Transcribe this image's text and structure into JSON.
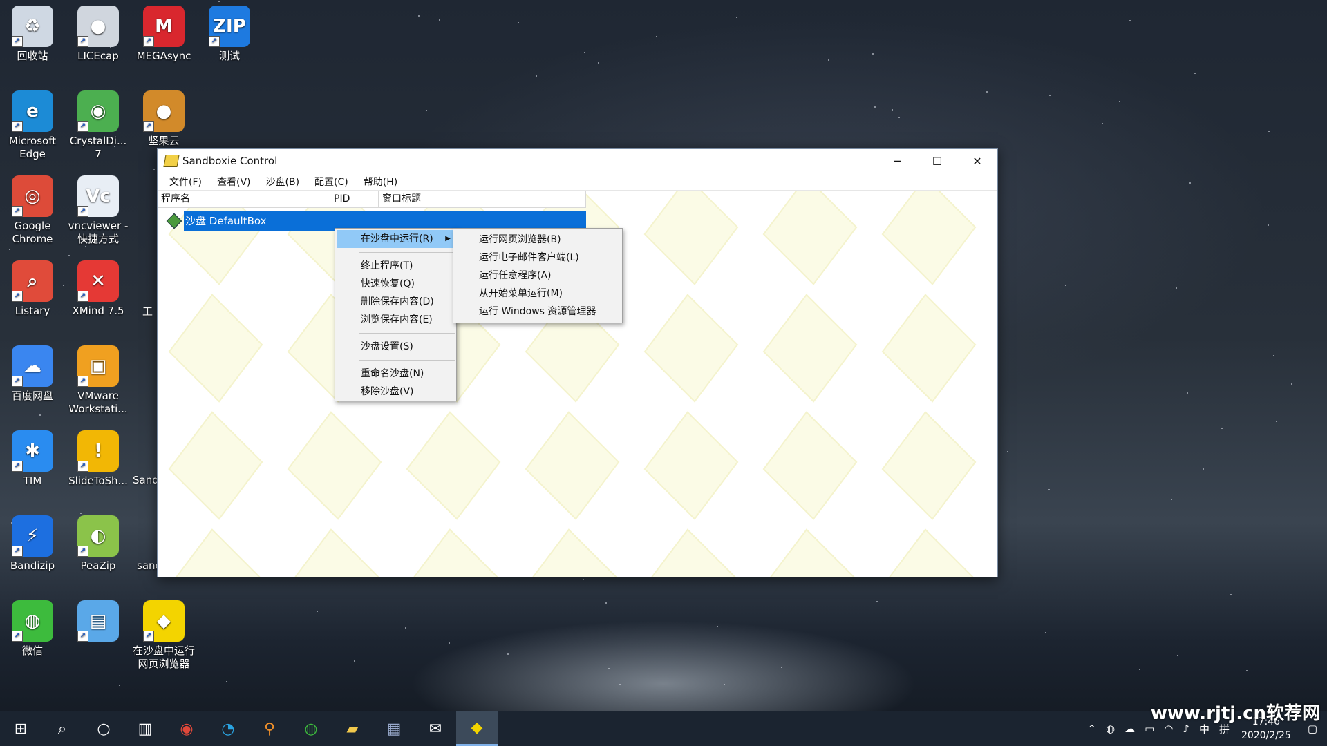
{
  "desktop": {
    "icons": [
      {
        "label": "回收站",
        "glyph": "♻",
        "color": "#cfd8e3"
      },
      {
        "label": "LICEcap",
        "glyph": "●",
        "color": "#d0d6de"
      },
      {
        "label": "MEGAsync",
        "glyph": "M",
        "color": "#d9272e"
      },
      {
        "label": "测试",
        "glyph": "ZIP",
        "color": "#1e7ae0"
      },
      {
        "label": "Microsoft Edge",
        "glyph": "e",
        "color": "#1c8bd6"
      },
      {
        "label": "CrystalDi... 7",
        "glyph": "◉",
        "color": "#4caf50"
      },
      {
        "label": "坚果云",
        "glyph": "●",
        "color": "#d28a2a"
      },
      {
        "label": "Google Chrome",
        "glyph": "◎",
        "color": "#dd4b39"
      },
      {
        "label": "vncviewer - 快捷方式",
        "glyph": "Vc",
        "color": "#e8eef5"
      },
      {
        "label": "Listary",
        "glyph": "⌕",
        "color": "#e04b3a"
      },
      {
        "label": "XMind 7.5",
        "glyph": "✕",
        "color": "#e53935"
      },
      {
        "label": "百度网盘",
        "glyph": "☁",
        "color": "#3a86f0"
      },
      {
        "label": "VMware Workstati...",
        "glyph": "▣",
        "color": "#f0a020"
      },
      {
        "label": "TIM",
        "glyph": "✱",
        "color": "#2a8cf0"
      },
      {
        "label": "SlideToSh...",
        "glyph": "!",
        "color": "#f2b705"
      },
      {
        "label": "Bandizip",
        "glyph": "⚡",
        "color": "#1d6fe0"
      },
      {
        "label": "PeaZip",
        "glyph": "◐",
        "color": "#8bc34a"
      },
      {
        "label": "微信",
        "glyph": "◍",
        "color": "#3dbb3d"
      },
      {
        "label": "",
        "glyph": "▤",
        "color": "#5aa8e8"
      },
      {
        "label": "在沙盘中运行网页浏览器",
        "glyph": "◆",
        "color": "#f3d400"
      }
    ],
    "partial_labels": [
      "工",
      "Sand",
      "sand"
    ]
  },
  "window": {
    "title": "Sandboxie Control",
    "controls": {
      "minimize": "─",
      "maximize": "☐",
      "close": "✕"
    },
    "menubar": [
      "文件(F)",
      "查看(V)",
      "沙盘(B)",
      "配置(C)",
      "帮助(H)"
    ],
    "columns": [
      "程序名",
      "PID",
      "窗口标题"
    ],
    "selected_row": "沙盘 DefaultBox"
  },
  "context_menu": {
    "items": [
      "在沙盘中运行(R)",
      "终止程序(T)",
      "快速恢复(Q)",
      "删除保存内容(D)",
      "浏览保存内容(E)",
      "沙盘设置(S)",
      "重命名沙盘(N)",
      "移除沙盘(V)"
    ],
    "submenu_arrow": "▶"
  },
  "submenu": {
    "items": [
      "运行网页浏览器(B)",
      "运行电子邮件客户端(L)",
      "运行任意程序(A)",
      "从开始菜单运行(M)",
      "运行 Windows 资源管理器"
    ]
  },
  "taskbar": {
    "icons": [
      "windows-logo",
      "search",
      "cortana",
      "task-view",
      "chrome",
      "edge",
      "listary",
      "wechat",
      "file-explorer",
      "store",
      "mail",
      "sandboxie"
    ],
    "tray": {
      "ime_lang": "中",
      "ime_mode": "拼",
      "time": "17:46",
      "date": "2020/2/25"
    }
  },
  "watermark": "www.rjtj.cn软荐网"
}
